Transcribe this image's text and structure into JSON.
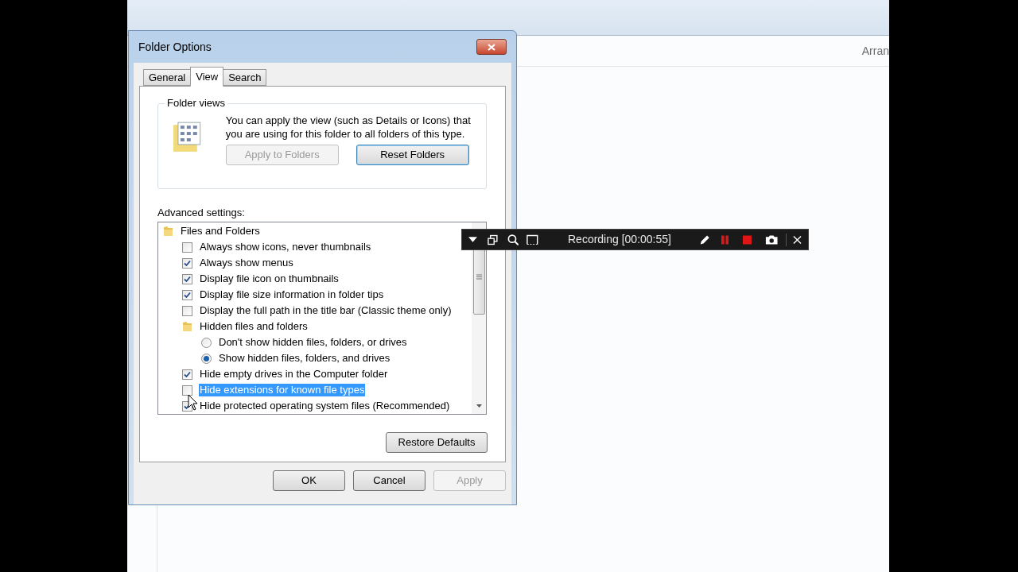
{
  "explorer": {
    "arrange_label": "Arran"
  },
  "dialog": {
    "title": "Folder Options",
    "tabs": [
      {
        "label": "General",
        "selected": false
      },
      {
        "label": "View",
        "selected": true
      },
      {
        "label": "Search",
        "selected": false
      }
    ],
    "folder_views": {
      "legend": "Folder views",
      "description": "You can apply the view (such as Details or Icons) that you are using for this folder to all folders of this type.",
      "buttons": [
        {
          "label": "Apply to Folders",
          "disabled": true,
          "default": false
        },
        {
          "label": "Reset Folders",
          "disabled": false,
          "default": true
        }
      ]
    },
    "advanced_label": "Advanced settings:",
    "settings": [
      {
        "kind": "folder",
        "label": "Files and Folders",
        "selected": false,
        "children": [
          {
            "kind": "checkbox",
            "label": "Always show icons, never thumbnails",
            "checked": false,
            "selected": false
          },
          {
            "kind": "checkbox",
            "label": "Always show menus",
            "checked": true,
            "selected": false
          },
          {
            "kind": "checkbox",
            "label": "Display file icon on thumbnails",
            "checked": true,
            "selected": false
          },
          {
            "kind": "checkbox",
            "label": "Display file size information in folder tips",
            "checked": true,
            "selected": false
          },
          {
            "kind": "checkbox",
            "label": "Display the full path in the title bar (Classic theme only)",
            "checked": false,
            "selected": false
          },
          {
            "kind": "folder",
            "label": "Hidden files and folders",
            "selected": false,
            "children": [
              {
                "kind": "radio",
                "label": "Don't show hidden files, folders, or drives",
                "checked": false,
                "selected": false
              },
              {
                "kind": "radio",
                "label": "Show hidden files, folders, and drives",
                "checked": true,
                "selected": false
              }
            ]
          },
          {
            "kind": "checkbox",
            "label": "Hide empty drives in the Computer folder",
            "checked": true,
            "selected": false
          },
          {
            "kind": "checkbox",
            "label": "Hide extensions for known file types",
            "checked": false,
            "selected": true
          },
          {
            "kind": "checkbox",
            "label": "Hide protected operating system files (Recommended)",
            "checked": true,
            "selected": false
          }
        ]
      }
    ],
    "restore_button": "Restore Defaults",
    "footer_buttons": [
      {
        "label": "OK",
        "disabled": false
      },
      {
        "label": "Cancel",
        "disabled": false
      },
      {
        "label": "Apply",
        "disabled": true
      }
    ]
  },
  "recorder": {
    "status": "Recording [00:00:55]"
  }
}
